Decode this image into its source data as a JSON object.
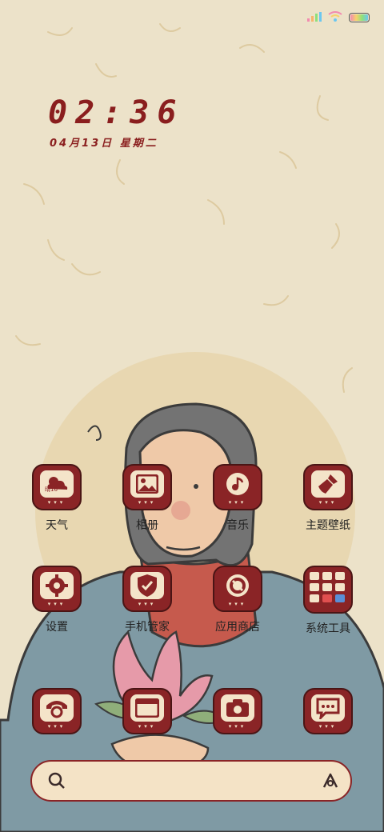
{
  "status_bar": {
    "signal_icon": "signal-bars-icon",
    "wifi_icon": "wifi-icon",
    "battery_icon": "battery-icon"
  },
  "clock": {
    "time": "02:36",
    "date": "04月13日 星期二"
  },
  "apps": [
    {
      "label": "天气",
      "icon": "weather-icon",
      "badge": "晴16°"
    },
    {
      "label": "相册",
      "icon": "gallery-icon"
    },
    {
      "label": "音乐",
      "icon": "music-icon"
    },
    {
      "label": "主题壁纸",
      "icon": "theme-brush-icon"
    },
    {
      "label": "设置",
      "icon": "settings-gear-icon"
    },
    {
      "label": "手机管家",
      "icon": "security-shield-icon"
    },
    {
      "label": "应用商店",
      "icon": "app-store-icon"
    },
    {
      "label": "系统工具",
      "icon": "system-tools-folder-icon"
    }
  ],
  "dock": [
    {
      "icon": "phone-icon"
    },
    {
      "icon": "browser-icon"
    },
    {
      "icon": "camera-icon"
    },
    {
      "icon": "messages-icon"
    }
  ],
  "search": {
    "search_icon": "search-icon",
    "assistant_icon": "assistant-icon"
  },
  "colors": {
    "accent": "#8a2426",
    "tile_inner": "#f4e4c9",
    "background": "#ece2c9"
  }
}
